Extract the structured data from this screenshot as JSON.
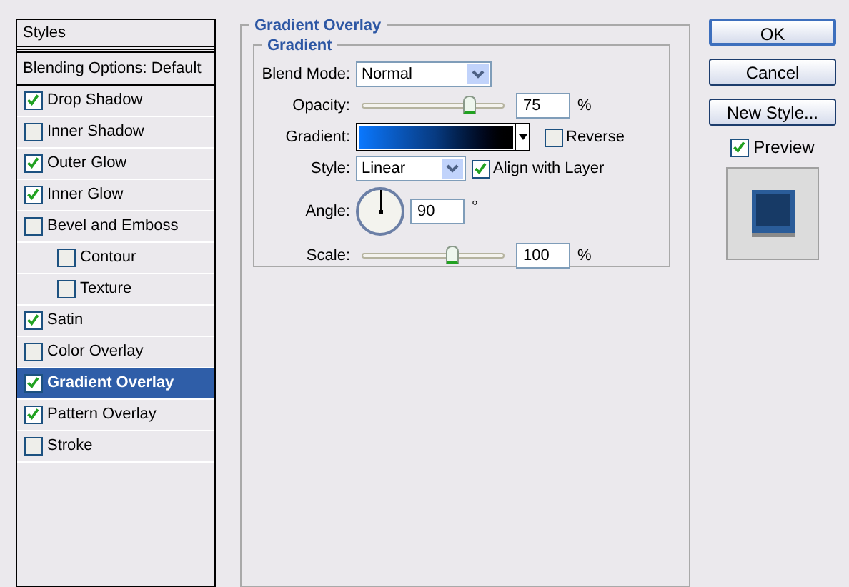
{
  "styles_panel": {
    "header": "Styles",
    "blending_options": {
      "label": "Blending Options: Default",
      "selected": false
    },
    "items": [
      {
        "label": "Drop Shadow",
        "checked": true,
        "selected": false
      },
      {
        "label": "Inner Shadow",
        "checked": false,
        "selected": false
      },
      {
        "label": "Outer Glow",
        "checked": true,
        "selected": false
      },
      {
        "label": "Inner Glow",
        "checked": true,
        "selected": false
      },
      {
        "label": "Bevel and Emboss",
        "checked": false,
        "selected": false,
        "children": [
          {
            "label": "Contour",
            "checked": false,
            "selected": false
          },
          {
            "label": "Texture",
            "checked": false,
            "selected": false
          }
        ]
      },
      {
        "label": "Satin",
        "checked": true,
        "selected": false
      },
      {
        "label": "Color Overlay",
        "checked": false,
        "selected": false
      },
      {
        "label": "Gradient Overlay",
        "checked": true,
        "selected": true
      },
      {
        "label": "Pattern Overlay",
        "checked": true,
        "selected": false
      },
      {
        "label": "Stroke",
        "checked": false,
        "selected": false
      }
    ]
  },
  "gradient_overlay": {
    "title": "Gradient Overlay",
    "group_title": "Gradient",
    "blend_mode": {
      "label": "Blend Mode:",
      "value": "Normal"
    },
    "opacity": {
      "label": "Opacity:",
      "level": 0.76,
      "value": "75",
      "unit": "%"
    },
    "gradient": {
      "label": "Gradient:",
      "reverse": {
        "label": "Reverse",
        "checked": false
      }
    },
    "style": {
      "label": "Style:",
      "value": "Linear",
      "align_with_layer": {
        "label": "Align with Layer",
        "checked": true
      }
    },
    "angle": {
      "label": "Angle:",
      "value": "90",
      "unit": "°"
    },
    "scale": {
      "label": "Scale:",
      "level": 0.63,
      "value": "100",
      "unit": "%"
    }
  },
  "buttons": [
    {
      "label": "OK",
      "default": true
    },
    {
      "label": "Cancel",
      "default": false
    },
    {
      "label": "New Style...",
      "default": false
    }
  ],
  "preview": {
    "label": "Preview",
    "checked": true
  }
}
